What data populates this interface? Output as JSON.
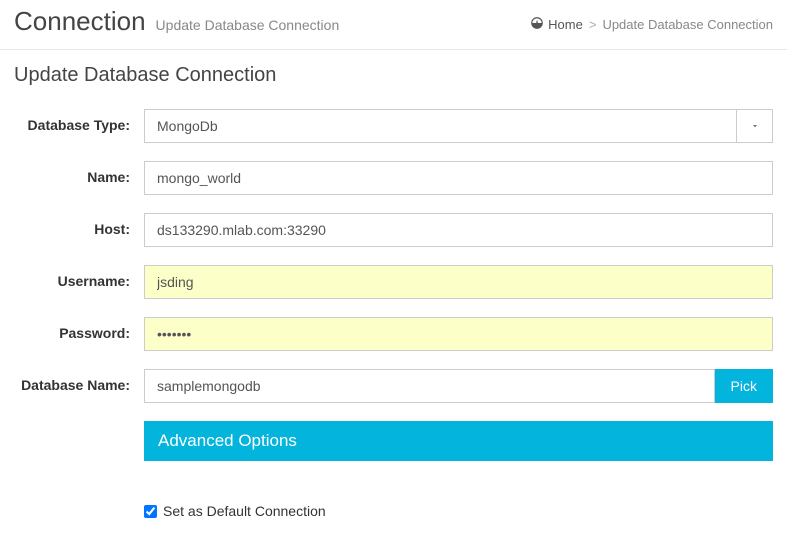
{
  "header": {
    "title": "Connection",
    "subtitle": "Update Database Connection",
    "breadcrumbs": {
      "home": "Home",
      "current": "Update Database Connection"
    }
  },
  "panel": {
    "title": "Update Database Connection",
    "fields": {
      "db_type": {
        "label": "Database Type:",
        "value": "MongoDb"
      },
      "name": {
        "label": "Name:",
        "value": "mongo_world"
      },
      "host": {
        "label": "Host:",
        "value": "ds133290.mlab.com:33290"
      },
      "username": {
        "label": "Username:",
        "value": "jsding"
      },
      "password": {
        "label": "Password:",
        "value": "•••••••"
      },
      "db_name": {
        "label": "Database Name:",
        "value": "samplemongodb",
        "pick": "Pick"
      }
    },
    "advanced": "Advanced Options",
    "default_check": {
      "label": "Set as Default Connection",
      "checked": true
    }
  }
}
